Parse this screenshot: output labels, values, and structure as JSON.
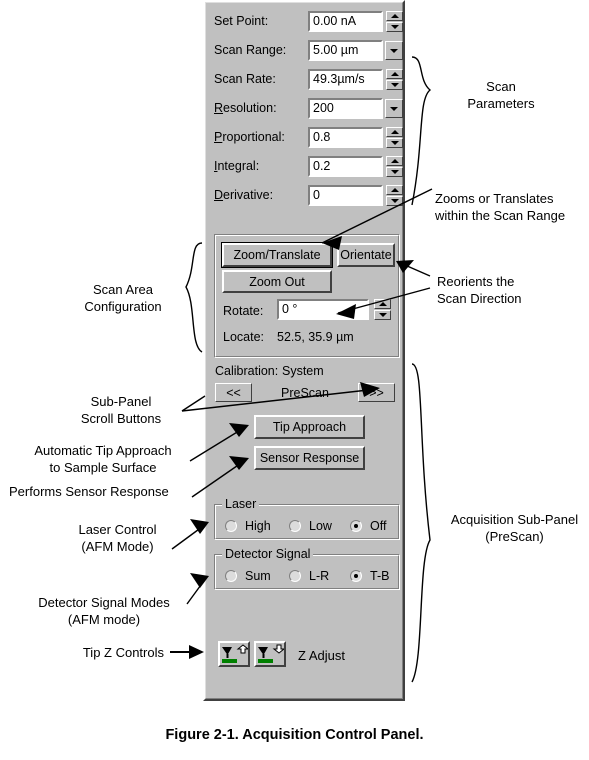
{
  "figure": {
    "caption": "Figure 2-1.  Acquisition Control Panel."
  },
  "panel": {
    "scan_parameters": {
      "fields": [
        {
          "label": "Set Point:",
          "underline": "",
          "value": "0.00 nA",
          "control": "spinner"
        },
        {
          "label": "Scan Range:",
          "underline": "",
          "value": "5.00 µm",
          "control": "dropdown"
        },
        {
          "label": "Scan Rate:",
          "underline": "",
          "value": "49.3µm/s",
          "control": "spinner"
        },
        {
          "label": "Resolution:",
          "underline": "R",
          "value": "200",
          "control": "dropdown"
        },
        {
          "label": "Proportional:",
          "underline": "P",
          "value": "0.8",
          "control": "spinner"
        },
        {
          "label": "Integral:",
          "underline": "I",
          "value": "0.2",
          "control": "spinner"
        },
        {
          "label": "Derivative:",
          "underline": "D",
          "value": "0",
          "control": "spinner"
        }
      ]
    },
    "scan_area": {
      "zoom_translate_label": "Zoom/Translate",
      "orientate_label": "Orientate",
      "zoom_out_label": "Zoom Out",
      "rotate_label": "Rotate:",
      "rotate_value": "0 °",
      "locate_label": "Locate:",
      "locate_value": "52.5, 35.9 µm"
    },
    "acquisition": {
      "calibration_label": "Calibration:",
      "calibration_value": "System",
      "scroll_prev": "<<",
      "subpanel_name": "PreScan",
      "scroll_next": ">>",
      "tip_approach_label": "Tip Approach",
      "sensor_response_label": "Sensor Response",
      "laser": {
        "group_label": "Laser",
        "options": [
          {
            "label": "High",
            "selected": false
          },
          {
            "label": "Low",
            "selected": false
          },
          {
            "label": "Off",
            "selected": true
          }
        ]
      },
      "detector": {
        "group_label": "Detector Signal",
        "options": [
          {
            "label": "Sum",
            "selected": false
          },
          {
            "label": "L-R",
            "selected": false
          },
          {
            "label": "T-B",
            "selected": true
          }
        ]
      },
      "z_adjust_label": "Z Adjust",
      "z_up_icon": "tip-up-icon",
      "z_down_icon": "tip-down-icon"
    }
  },
  "annotations": {
    "scan_parameters": {
      "line1": "Scan",
      "line2": "Parameters"
    },
    "zooms_translates": {
      "line1": "Zooms or Translates",
      "line2": "within the Scan Range"
    },
    "reorients": {
      "line1": "Reorients the",
      "line2": "Scan Direction"
    },
    "scan_area_config": {
      "line1": "Scan Area",
      "line2": "Configuration"
    },
    "scroll_buttons": {
      "line1": "Sub-Panel",
      "line2": "Scroll Buttons"
    },
    "tip_approach": {
      "line1": "Automatic Tip Approach",
      "line2": "to Sample Surface"
    },
    "sensor_response": {
      "line1": "Performs Sensor Response",
      "line2": ""
    },
    "laser_control": {
      "line1": "Laser Control",
      "line2": "(AFM Mode)"
    },
    "detector_modes": {
      "line1": "Detector Signal Modes",
      "line2": "(AFM mode)"
    },
    "tip_z_controls": {
      "line1": "Tip Z Controls",
      "line2": ""
    },
    "acquisition_subpanel": {
      "line1": "Acquisition Sub-Panel",
      "line2": "(PreScan)"
    }
  },
  "colors": {
    "panel_face": "#c0c0c0",
    "field_bg": "#ffffff",
    "shadow": "#404040",
    "highlight": "#ffffff",
    "tip_surface_green": "#008000",
    "text": "#000000"
  }
}
